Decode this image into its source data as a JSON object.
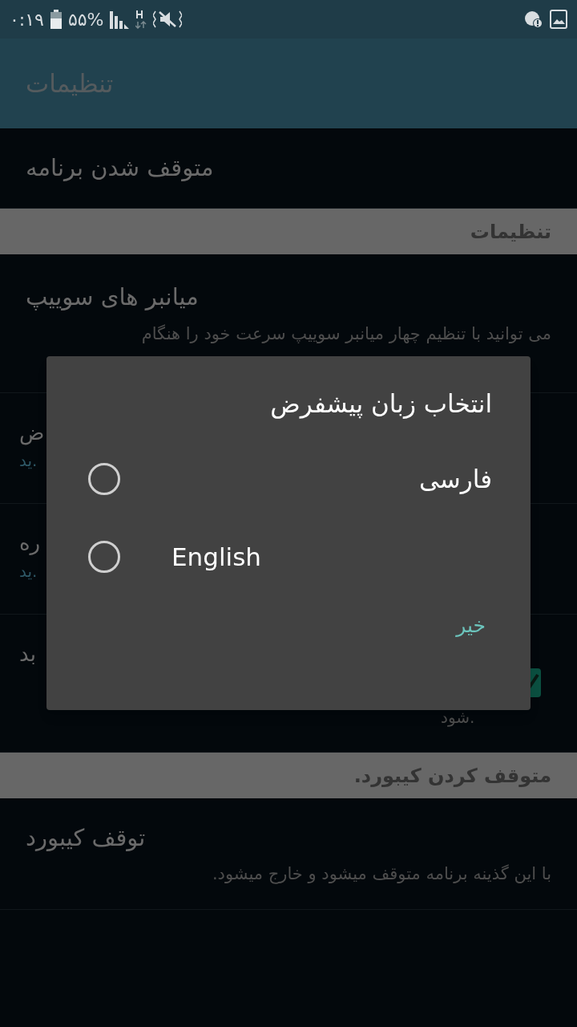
{
  "status_bar": {
    "time": "۰:۱۹",
    "battery": "۵۵%"
  },
  "app_bar": {
    "title": "تنظیمات"
  },
  "rows": [
    {
      "kind": "item",
      "title": "متوقف شدن برنامه"
    },
    {
      "kind": "header",
      "title": "تنظیمات"
    },
    {
      "kind": "item",
      "title": "میانبر های سوییپ",
      "subtitle": "می توانید با تنظیم چهار میانبر سوییپ سرعت خود را هنگام"
    },
    {
      "kind": "covered",
      "title": "ض",
      "subtitle": "ید."
    },
    {
      "kind": "covered",
      "title": "ره",
      "subtitle": "ید."
    },
    {
      "kind": "covered_check",
      "title": "بد",
      "subtitle": "شود.",
      "checked": true
    },
    {
      "kind": "header",
      "title": "متوقف کردن کیبورد."
    },
    {
      "kind": "item",
      "title": "توقف کیبورد",
      "subtitle": "با این گذینه برنامه متوقف میشود و خارج میشود."
    }
  ],
  "dialog": {
    "title": "انتخاب زبان پیشفرض",
    "options": [
      {
        "label": "فارسی",
        "selected": false
      },
      {
        "label": "English",
        "selected": false
      }
    ],
    "buttons": [
      "خیر"
    ]
  }
}
